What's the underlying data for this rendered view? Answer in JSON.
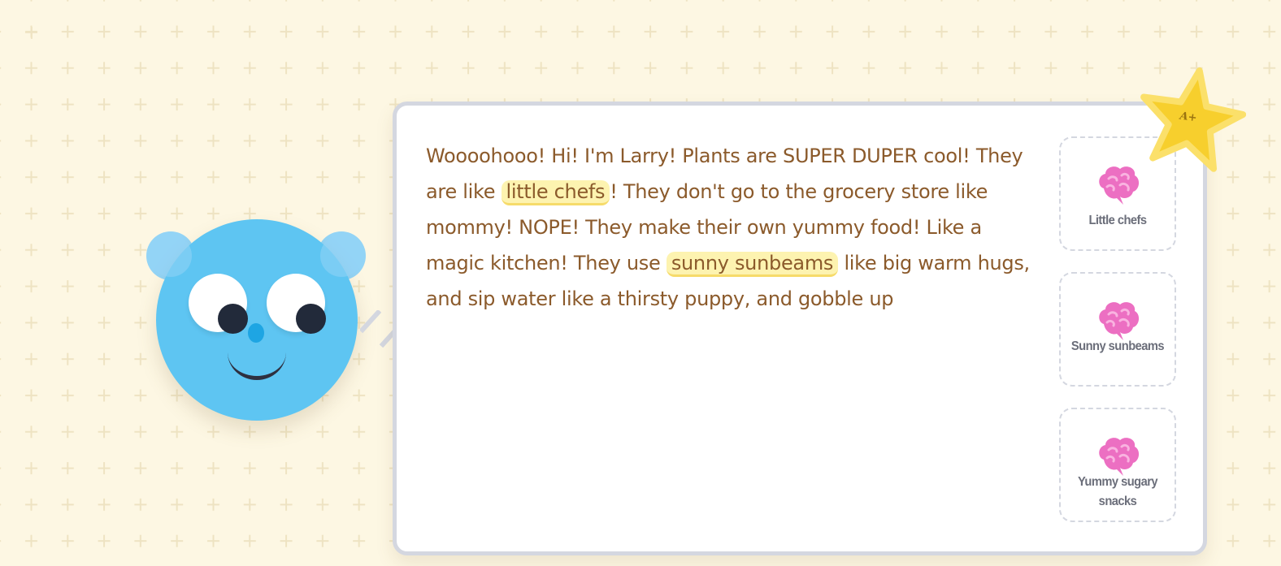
{
  "speech": {
    "segments": [
      {
        "text": "Woooohooo! Hi! I'm Larry! Plants are SUPER DUPER cool! They are like ",
        "highlight": false
      },
      {
        "text": "little chefs",
        "highlight": true
      },
      {
        "text": "! They don't go to the grocery store like mommy! NOPE! They make their own yummy food! Like a magic kitchen! They use ",
        "highlight": false
      },
      {
        "text": "sunny sunbeams",
        "highlight": true
      },
      {
        "text": " like big warm hugs, and sip water like a thirsty puppy, and gobble up",
        "highlight": false
      }
    ]
  },
  "concepts": [
    {
      "label": "Little chefs",
      "icon": "brain-icon"
    },
    {
      "label": "Sunny sunbeams",
      "icon": "brain-icon"
    },
    {
      "label": "Yummy sugary snacks",
      "icon": "brain-icon"
    }
  ],
  "badge": {
    "grade": "A+",
    "icon": "star-icon"
  },
  "colors": {
    "background": "#fdf7e3",
    "character": "#5ec5f2",
    "speech_text": "#8b5a2b",
    "highlight": "#fdf3b0",
    "star": "#f7cf2d",
    "brain": "#ec6fc2"
  }
}
